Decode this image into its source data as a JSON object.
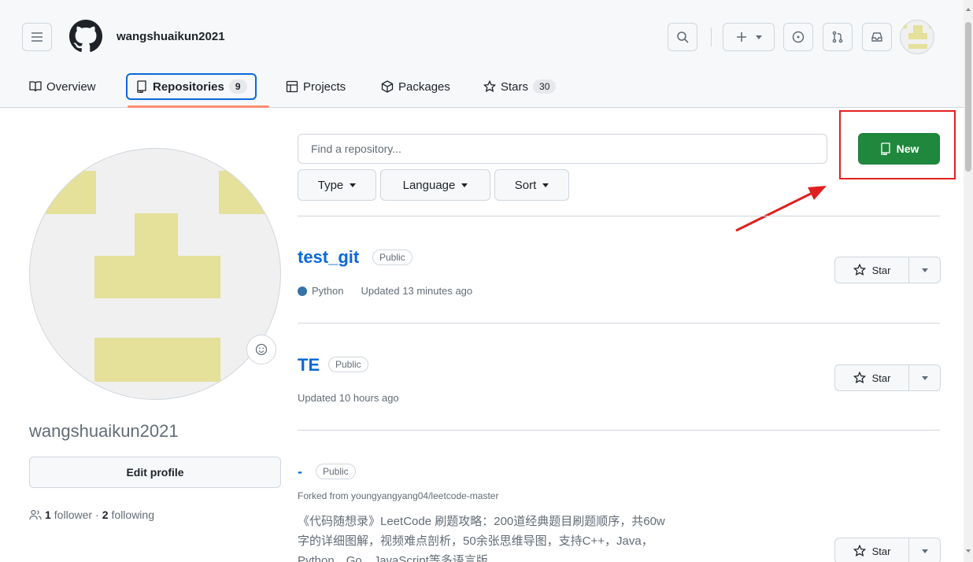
{
  "header": {
    "username": "wangshuaikun2021"
  },
  "nav": {
    "overview": "Overview",
    "repositories": "Repositories",
    "repositories_count": "9",
    "projects": "Projects",
    "packages": "Packages",
    "stars": "Stars",
    "stars_count": "30"
  },
  "search": {
    "placeholder": "Find a repository..."
  },
  "filters": {
    "type": "Type",
    "language": "Language",
    "sort": "Sort"
  },
  "new_button": "New",
  "profile": {
    "name": "wangshuaikun2021",
    "edit_label": "Edit profile",
    "followers_count": "1",
    "followers_label": "follower",
    "separator": "·",
    "following_count": "2",
    "following_label": "following"
  },
  "repos": [
    {
      "name": "test_git",
      "visibility": "Public",
      "language": "Python",
      "updated": "Updated 13 minutes ago",
      "star_label": "Star"
    },
    {
      "name": "TE",
      "visibility": "Public",
      "updated": "Updated 10 hours ago",
      "star_label": "Star"
    },
    {
      "name": "-",
      "visibility": "Public",
      "forked_from": "Forked from youngyangyang04/leetcode-master",
      "description": "《代码随想录》LeetCode 刷题攻略：200道经典题目刷题顺序，共60w字的详细图解，视频难点剖析，50余张思维导图，支持C++，Java，Python，Go，JavaScript等多语言版",
      "star_label": "Star"
    }
  ],
  "colors": {
    "accent": "#0969da",
    "new_button": "#1f883d",
    "highlight": "#e02020",
    "underline": "#fd8c73",
    "python": "#3572A5",
    "avatar_block": "#e5e09a"
  }
}
